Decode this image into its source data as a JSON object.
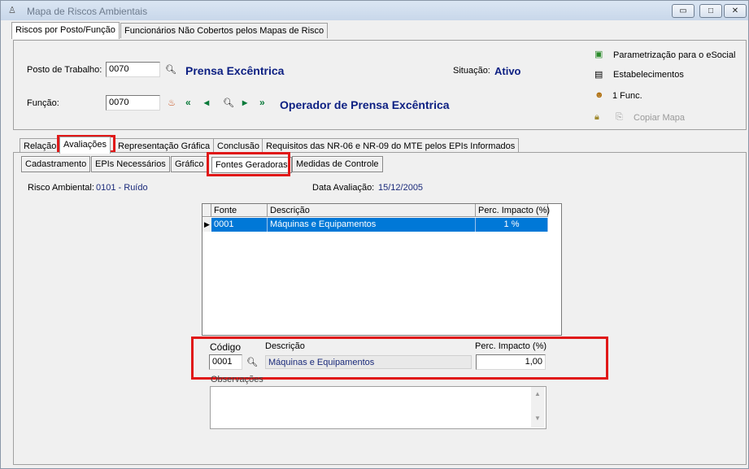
{
  "window": {
    "title": "Mapa de Riscos Ambientais",
    "controls": {
      "minimize": "▭",
      "maximize": "□",
      "close": "✕"
    }
  },
  "main_tabs": [
    "Riscos por Posto/Função",
    "Funcionários Não Cobertos pelos Mapas de Risco"
  ],
  "header": {
    "posto_label": "Posto de Trabalho:",
    "posto_code": "0070",
    "posto_name": "Prensa Excêntrica",
    "funcao_label": "Função:",
    "funcao_code": "0070",
    "funcao_name": "Operador de Prensa Excêntrica",
    "situacao_label": "Situação:",
    "situacao_value": "Ativo",
    "side_actions": [
      "Parametrização para o eSocial",
      "Estabelecimentos",
      "1 Func.",
      "Copiar Mapa"
    ]
  },
  "section_tabs": [
    "Relação",
    "Avaliações",
    "Representação Gráfica",
    "Conclusão",
    "Requisitos das NR-06 e NR-09 do MTE pelos EPIs Informados"
  ],
  "sub_tabs": [
    "Cadastramento",
    "EPIs Necessários",
    "Gráfico",
    "Fontes Geradoras",
    "Medidas de Controle"
  ],
  "risk": {
    "label": "Risco Ambiental:",
    "value": "0101 - Ruído",
    "date_label": "Data Avaliação:",
    "date_value": "15/12/2005"
  },
  "grid": {
    "columns": [
      "Fonte",
      "Descrição",
      "Perc. Impacto (%)"
    ],
    "rows": [
      {
        "fonte": "0001",
        "descricao": "Máquinas e Equipamentos",
        "perc": "1 %"
      }
    ]
  },
  "form": {
    "codigo_label": "Código",
    "codigo_value": "0001",
    "descricao_label": "Descrição",
    "descricao_value": "Máquinas e Equipamentos",
    "perc_label": "Perc. Impacto (%)",
    "perc_value": "1,00",
    "obs_label": "Observações"
  },
  "colors": {
    "accent_red": "#e01818",
    "selection_blue": "#0078d7",
    "name_blue": "#0c1f82"
  }
}
